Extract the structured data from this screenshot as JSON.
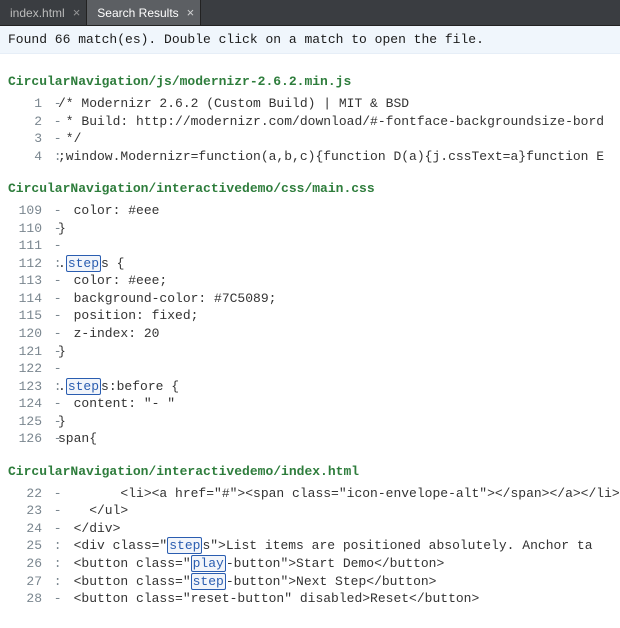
{
  "tabs": [
    {
      "label": "index.html",
      "active": false
    },
    {
      "label": "Search Results",
      "active": true
    }
  ],
  "summary": "Found 66 match(es). Double click on a match to open the file.",
  "search_term": "step",
  "groups": [
    {
      "path": "CircularNavigation/js/modernizr-2.6.2.min.js",
      "lines": [
        {
          "n": 1,
          "sep": "-",
          "pre": "/* Modernizr 2.6.2 (Custom Build) | MIT & BSD",
          "hl": "",
          "post": ""
        },
        {
          "n": 2,
          "sep": "-",
          "pre": " * Build: http://modernizr.com/download/#-fontface-backgroundsize-bord",
          "hl": "",
          "post": ""
        },
        {
          "n": 3,
          "sep": "-",
          "pre": " */",
          "hl": "",
          "post": ""
        },
        {
          "n": 4,
          "sep": ":",
          "pre": ";window.Modernizr=function(a,b,c){function D(a){j.cssText=a}function E",
          "hl": "",
          "post": ""
        }
      ]
    },
    {
      "path": "CircularNavigation/interactivedemo/css/main.css",
      "lines": [
        {
          "n": 109,
          "sep": "-",
          "pre": "  color: #eee",
          "hl": "",
          "post": ""
        },
        {
          "n": 110,
          "sep": "-",
          "pre": "}",
          "hl": "",
          "post": ""
        },
        {
          "n": 111,
          "sep": "-",
          "pre": "",
          "hl": "",
          "post": ""
        },
        {
          "n": 112,
          "sep": ":",
          "pre": ".",
          "hl": "step",
          "post": "s {"
        },
        {
          "n": 113,
          "sep": "-",
          "pre": "  color: #eee;",
          "hl": "",
          "post": ""
        },
        {
          "n": 114,
          "sep": "-",
          "pre": "  background-color: #7C5089;",
          "hl": "",
          "post": ""
        },
        {
          "n": 115,
          "sep": "-",
          "pre": "  position: fixed;",
          "hl": "",
          "post": ""
        },
        {
          "n": 120,
          "sep": "-",
          "pre": "  z-index: 20",
          "hl": "",
          "post": ""
        },
        {
          "n": 121,
          "sep": "-",
          "pre": "}",
          "hl": "",
          "post": ""
        },
        {
          "n": 122,
          "sep": "-",
          "pre": "",
          "hl": "",
          "post": ""
        },
        {
          "n": 123,
          "sep": ":",
          "pre": ".",
          "hl": "step",
          "post": "s:before {"
        },
        {
          "n": 124,
          "sep": "-",
          "pre": "  content: \"- \"",
          "hl": "",
          "post": ""
        },
        {
          "n": 125,
          "sep": "-",
          "pre": "}",
          "hl": "",
          "post": ""
        },
        {
          "n": 126,
          "sep": "-",
          "pre": "span{",
          "hl": "",
          "post": ""
        }
      ]
    },
    {
      "path": "CircularNavigation/interactivedemo/index.html",
      "lines": [
        {
          "n": 22,
          "sep": "-",
          "pre": "        <li><a href=\"#\"><span class=\"icon-envelope-alt\"></span></a></li>",
          "hl": "",
          "post": ""
        },
        {
          "n": 23,
          "sep": "-",
          "pre": "    </ul>",
          "hl": "",
          "post": ""
        },
        {
          "n": 24,
          "sep": "-",
          "pre": "  </div>",
          "hl": "",
          "post": ""
        },
        {
          "n": 25,
          "sep": ":",
          "pre": "  <div class=\"",
          "hl": "step",
          "post": "s\">List items are positioned absolutely. Anchor ta"
        },
        {
          "n": 26,
          "sep": ":",
          "pre": "  <button class=\"",
          "hl": "play",
          "post": "-button\">Start Demo</button>"
        },
        {
          "n": 27,
          "sep": ":",
          "pre": "  <button class=\"",
          "hl": "step",
          "post": "-button\">Next Step</button>"
        },
        {
          "n": 28,
          "sep": "-",
          "pre": "  <button class=\"reset-button\" disabled>Reset</button>",
          "hl": "",
          "post": ""
        }
      ]
    }
  ]
}
